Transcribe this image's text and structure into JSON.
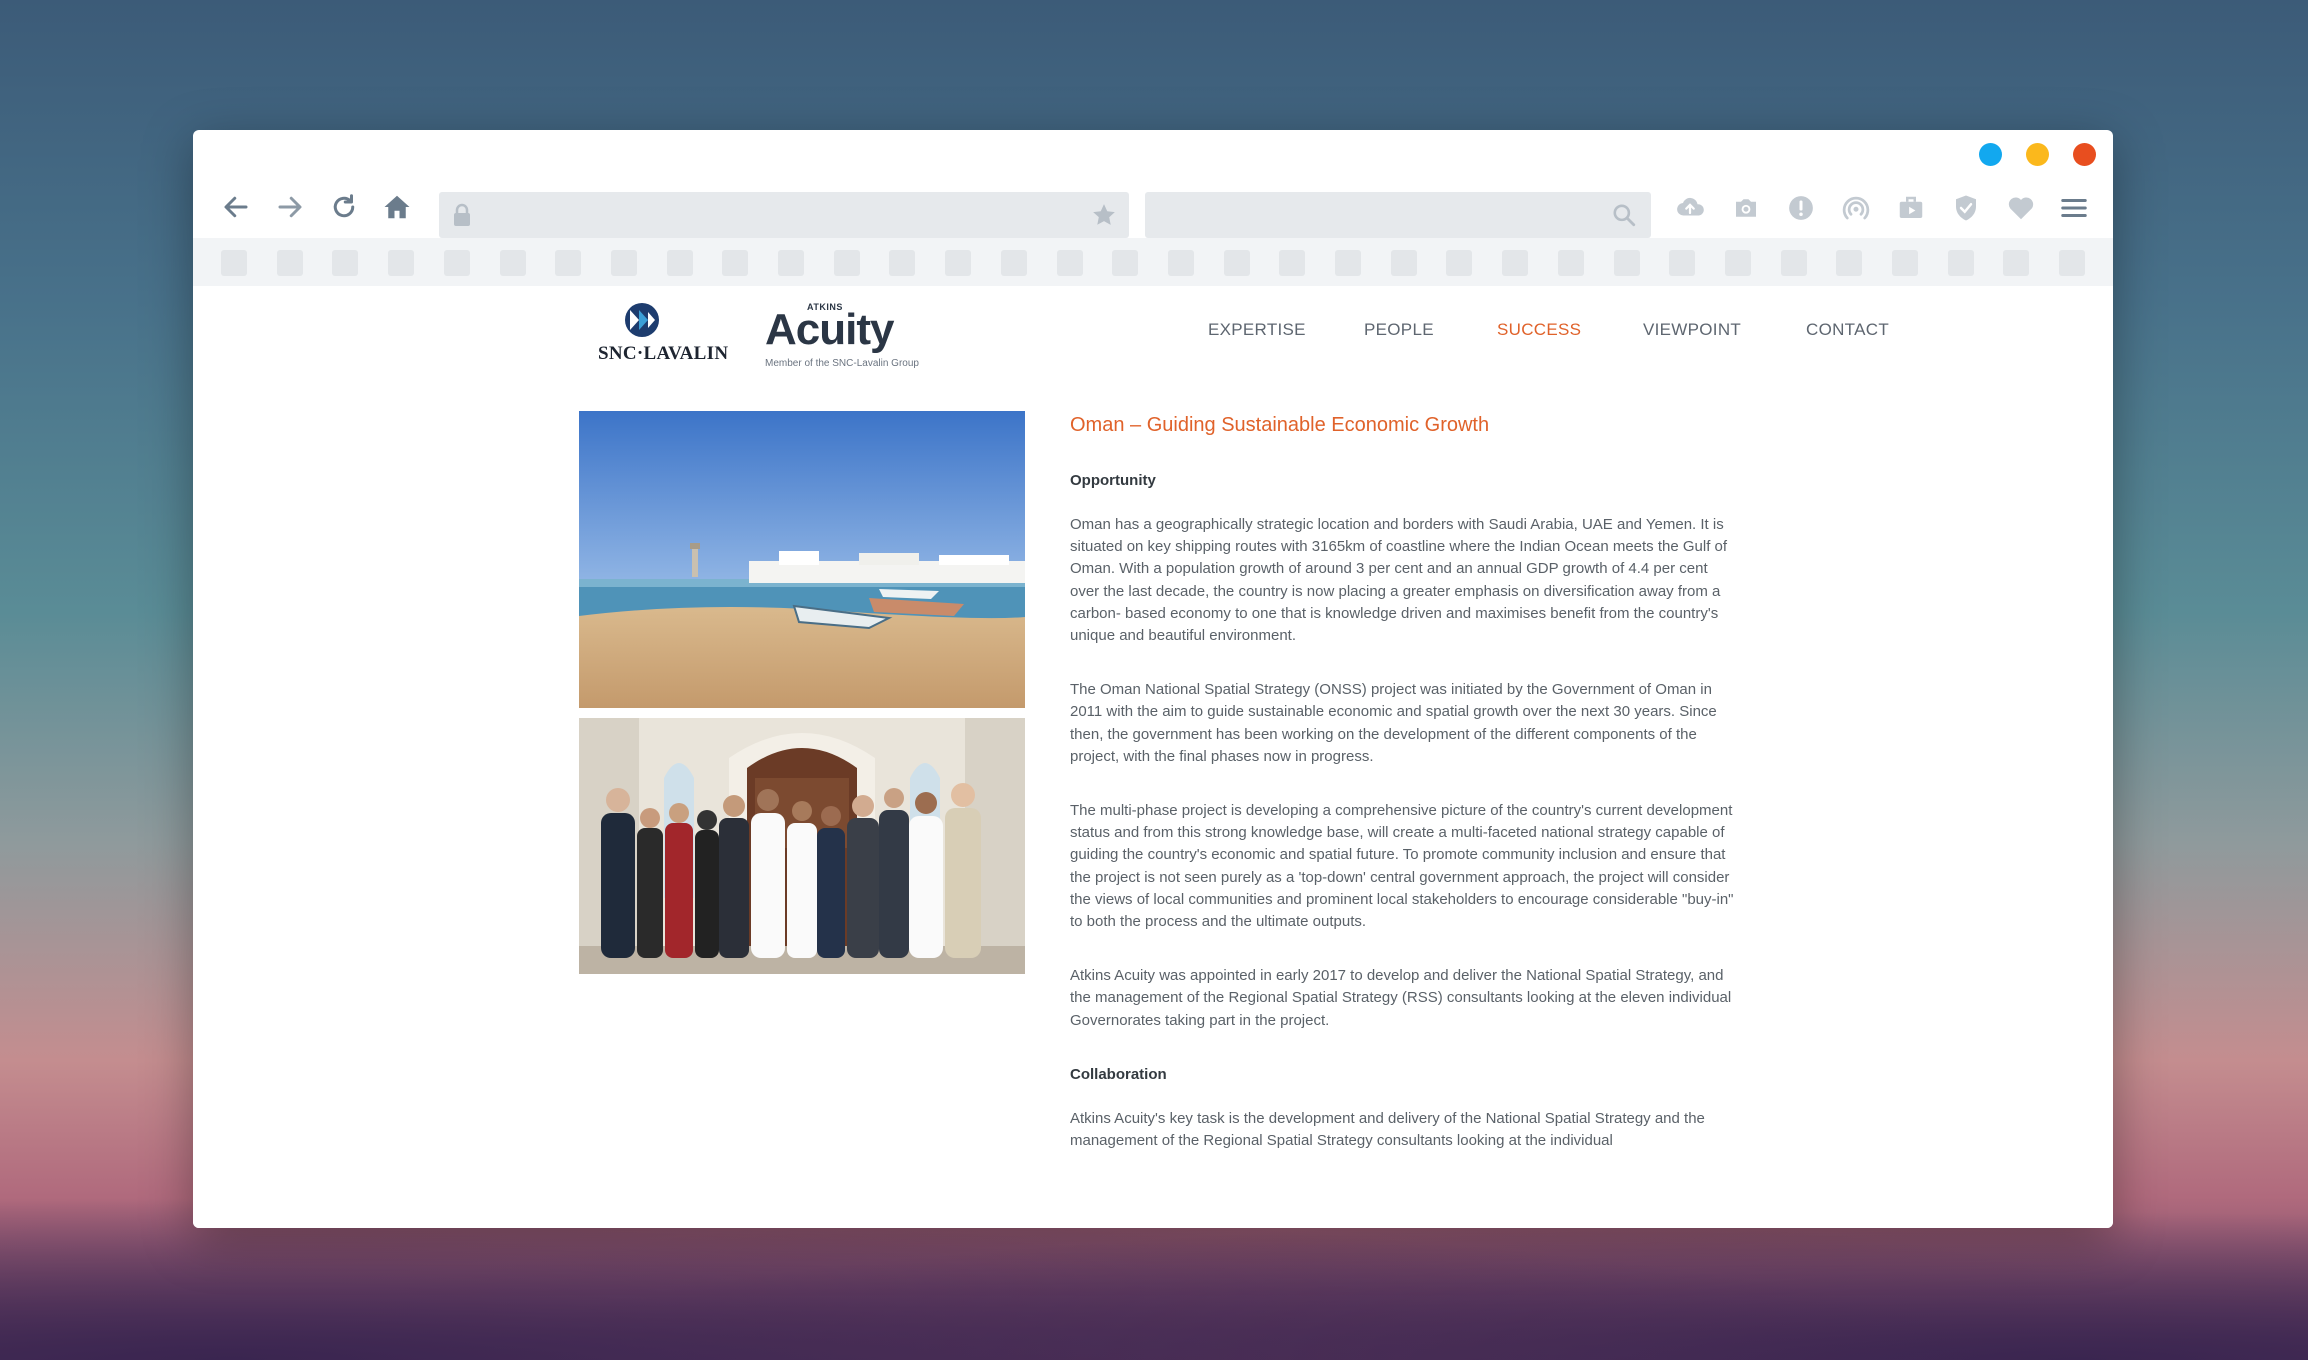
{
  "window": {
    "traffic_colors": [
      "#12a8ef",
      "#fbb81c",
      "#e84e1f"
    ]
  },
  "toolbar": {
    "icons": [
      "back-arrow-icon",
      "forward-arrow-icon",
      "reload-icon",
      "home-icon"
    ],
    "url_value": "",
    "search_value": "",
    "extension_icons": [
      "cloud-upload-icon",
      "camera-icon",
      "alert-icon",
      "broadcast-icon",
      "briefcase-icon",
      "shield-check-icon",
      "heart-icon",
      "menu-icon"
    ]
  },
  "site": {
    "logo_snc": "SNC·LAVALIN",
    "logo_acuity_small": "ATKINS",
    "logo_acuity_big": "Acuity",
    "logo_acuity_tagline": "Member of the SNC-Lavalin Group",
    "nav": [
      {
        "label": "EXPERTISE",
        "active": false
      },
      {
        "label": "PEOPLE",
        "active": false
      },
      {
        "label": "SUCCESS",
        "active": true
      },
      {
        "label": "VIEWPOINT",
        "active": false
      },
      {
        "label": "CONTACT",
        "active": false
      }
    ],
    "accent_color": "#e0622a"
  },
  "article": {
    "title": "Oman – Guiding Sustainable Economic Growth",
    "heading_opportunity": "Opportunity",
    "p1": "Oman has a geographically strategic location and borders with Saudi Arabia, UAE and Yemen. It is situated on key shipping routes with 3165km of coastline where the Indian Ocean meets the Gulf of Oman. With a population growth of around 3 per cent and an annual GDP growth of 4.4 per cent over the last decade, the country is now placing a greater emphasis on diversification away from a carbon- based economy to one that is knowledge driven and maximises benefit from the country's unique and beautiful environment.",
    "p2": "The Oman National Spatial Strategy (ONSS) project was initiated by the Government of Oman in 2011 with the aim to guide sustainable economic and spatial growth over the next 30 years. Since then, the government has been working on the development of the different components of the project, with the final phases now in progress.",
    "p3": "The multi-phase project is developing a comprehensive picture of the country's current development status and from this strong knowledge base, will create a multi-faceted national strategy capable of guiding the country's economic and spatial future. To promote community inclusion and ensure that the project is not seen purely as a 'top-down' central government approach, the project will consider the views of local communities and prominent local stakeholders to encourage considerable \"buy-in\" to both the process and the ultimate outputs.",
    "p4": "Atkins Acuity was appointed in early 2017 to develop and deliver the National Spatial Strategy, and the management of the Regional Spatial Strategy (RSS) consultants looking at the eleven individual Governorates taking part in the project.",
    "heading_collaboration": "Collaboration",
    "p5": "Atkins Acuity's key task is the development and delivery of the National Spatial Strategy and the management of the Regional Spatial Strategy consultants looking at the individual"
  }
}
